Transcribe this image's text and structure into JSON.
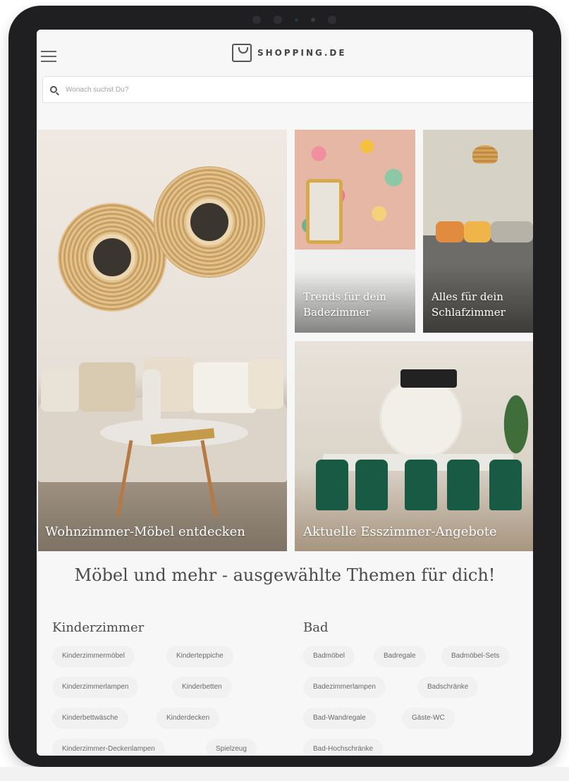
{
  "header": {
    "logo_text": "SHOPPING.DE",
    "search_placeholder": "Wonach suchst Du?"
  },
  "tiles": [
    {
      "caption": "Wohnzimmer-Möbel entdecken"
    },
    {
      "caption_line1": "Trends für dein",
      "caption_line2": "Badezimmer"
    },
    {
      "caption_line1": "Alles für dein",
      "caption_line2": "Schlafzimmer"
    },
    {
      "caption": "Aktuelle Esszimmer-Angebote"
    }
  ],
  "section_title": "Möbel und mehr - ausgewählte Themen für dich!",
  "columns": [
    {
      "title": "Kinderzimmer",
      "chips": [
        "Kinderzimmermöbel",
        "Kinderteppiche",
        "Kinderzimmerlampen",
        "Kinderbetten",
        "Kinderbettwäsche",
        "Kinderdecken",
        "Kinderzimmer-Deckenlampen",
        "Spielzeug"
      ]
    },
    {
      "title": "Bad",
      "chips": [
        "Badmöbel",
        "Badregale",
        "Badmöbel-Sets",
        "Badezimmerlampen",
        "Badschränke",
        "Bad-Wandregale",
        "Gäste-WC",
        "Bad-Hochschränke"
      ]
    }
  ],
  "colors": {
    "bezel": "#1f1f22",
    "page_bg": "#f7f7f7",
    "chip_bg": "#f1f1f1",
    "text": "#4b4b4b"
  },
  "icons": {
    "menu": "menu-icon",
    "logo": "shopping-bag-icon",
    "search": "search-icon"
  }
}
